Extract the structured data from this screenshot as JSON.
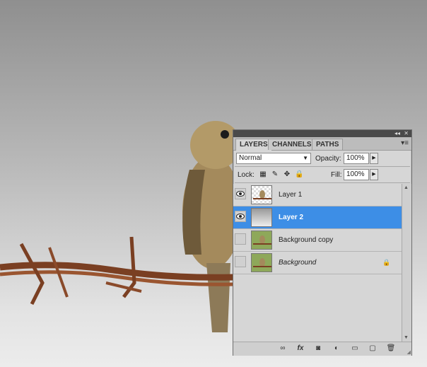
{
  "panel": {
    "tabs": [
      "LAYERS",
      "CHANNELS",
      "PATHS"
    ],
    "active_tab": "LAYERS",
    "blend_mode": "Normal",
    "opacity_label": "Opacity:",
    "opacity_value": "100%",
    "lock_label": "Lock:",
    "fill_label": "Fill:",
    "fill_value": "100%",
    "layers": [
      {
        "name": "Layer 1",
        "visible": true,
        "selected": false,
        "style": "normal"
      },
      {
        "name": "Layer 2",
        "visible": true,
        "selected": true,
        "style": "bold"
      },
      {
        "name": "Background copy",
        "visible": false,
        "selected": false,
        "style": "normal"
      },
      {
        "name": "Background",
        "visible": false,
        "selected": false,
        "style": "italic",
        "locked": true
      }
    ],
    "footer_icons": [
      "link-icon",
      "fx-icon",
      "mask-icon",
      "adjustment-icon",
      "group-folder-icon",
      "new-layer-icon",
      "trash-icon"
    ]
  },
  "colors": {
    "selection": "#3d8ee6",
    "panel_bg": "#d6d6d6",
    "rust": "#8a4a2a"
  }
}
